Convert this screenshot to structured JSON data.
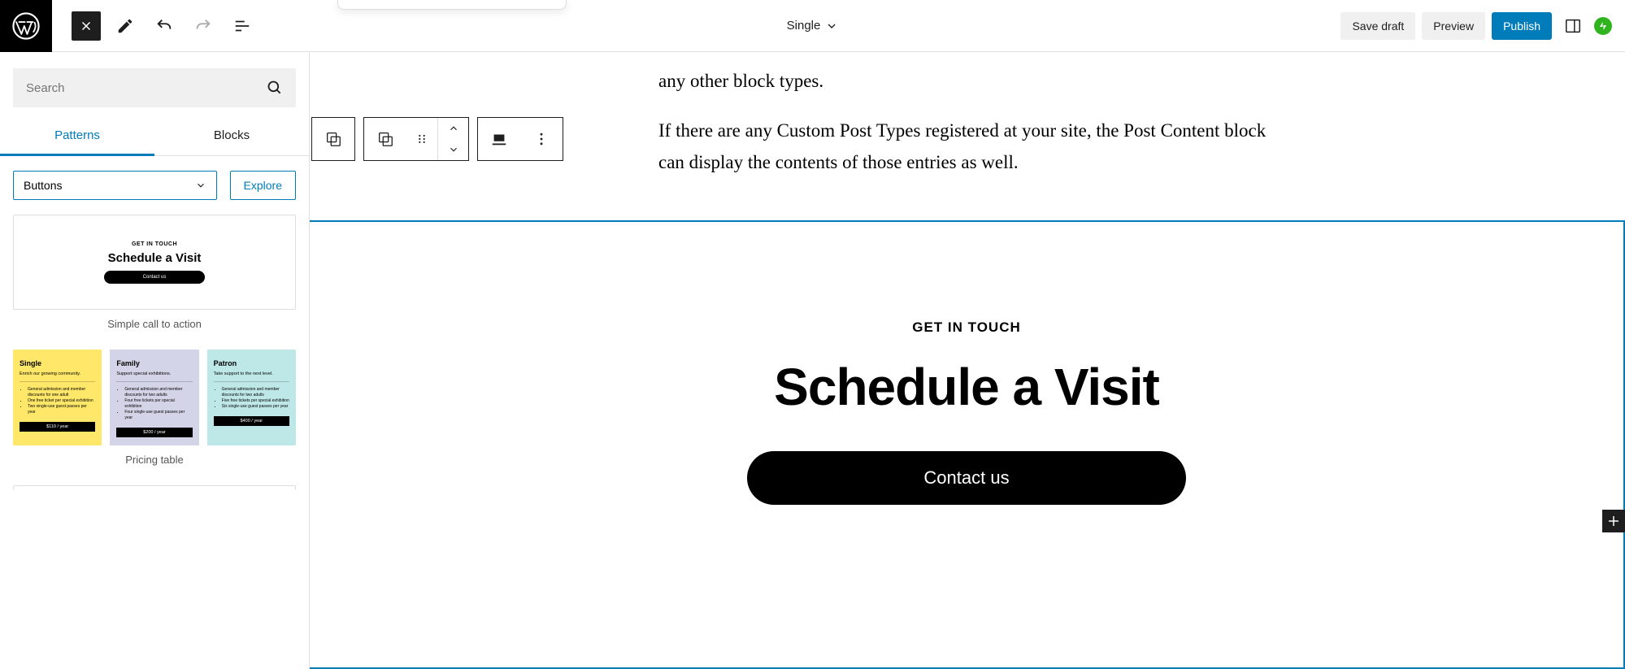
{
  "topbar": {
    "doc_title": "Single",
    "save_draft": "Save draft",
    "preview": "Preview",
    "publish": "Publish"
  },
  "sidebar": {
    "search_placeholder": "Search",
    "tabs": {
      "patterns": "Patterns",
      "blocks": "Blocks"
    },
    "category_selected": "Buttons",
    "explore": "Explore",
    "pattern1": {
      "overline": "GET IN TOUCH",
      "heading": "Schedule a Visit",
      "button": "Contact us",
      "label": "Simple call to action"
    },
    "pattern2": {
      "label": "Pricing table",
      "cols": [
        {
          "title": "Single",
          "sub": "Enrich our growing community.",
          "items": [
            "General admission and member discounts for one adult",
            "One free ticket per special exhibition",
            "Two single-use guest passes per year"
          ],
          "price": "$110 / year"
        },
        {
          "title": "Family",
          "sub": "Support special exhibitions.",
          "items": [
            "General admission and member discounts for two adults",
            "Four free tickets per special exhibition",
            "Four single-use guest passes per year"
          ],
          "price": "$200 / year"
        },
        {
          "title": "Patron",
          "sub": "Take support to the next level.",
          "items": [
            "General admission and member discounts for two adults",
            "Five free tickets per special exhibition",
            "Six single-use guest passes per year"
          ],
          "price": "$400 / year"
        }
      ]
    }
  },
  "canvas": {
    "para_a_tail": "any other block types.",
    "para_b": "If there are any Custom Post Types registered at your site, the Post Content block can display the contents of those entries as well.",
    "cta_overline": "GET IN TOUCH",
    "cta_heading": "Schedule a Visit",
    "cta_button": "Contact us"
  }
}
